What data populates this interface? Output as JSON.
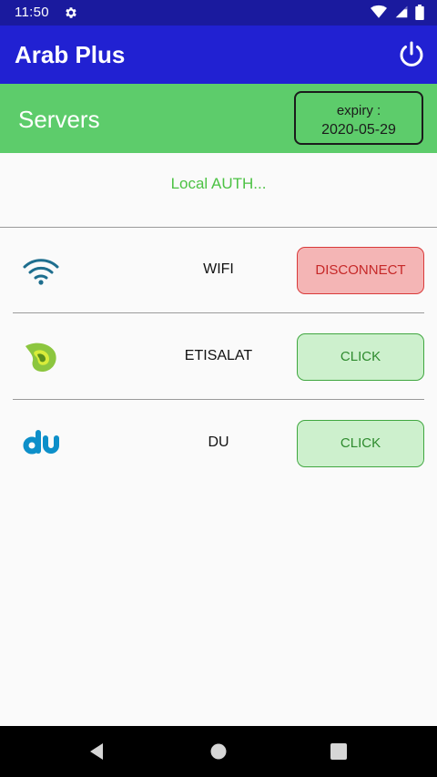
{
  "status_bar": {
    "time": "11:50",
    "icons": [
      "gear-icon",
      "wifi-icon",
      "signal-icon",
      "battery-icon"
    ]
  },
  "app_bar": {
    "title": "Arab Plus",
    "power_icon": "power-icon",
    "color": "#2121d2"
  },
  "servers_header": {
    "title": "Servers",
    "expiry_label": "expiry :",
    "expiry_date": "2020-05-29",
    "color": "#5dcc6b"
  },
  "auth_status": "Local AUTH...",
  "servers": [
    {
      "name": "WIFI",
      "icon": "wifi-logo-icon",
      "button": "DISCONNECT",
      "button_state": "connected"
    },
    {
      "name": "ETISALAT",
      "icon": "etisalat-logo-icon",
      "button": "CLICK",
      "button_state": "idle"
    },
    {
      "name": "DU",
      "icon": "du-logo-icon",
      "button": "CLICK",
      "button_state": "idle"
    }
  ],
  "nav_bar": {
    "icons": [
      "back-icon",
      "home-icon",
      "recents-icon"
    ]
  }
}
